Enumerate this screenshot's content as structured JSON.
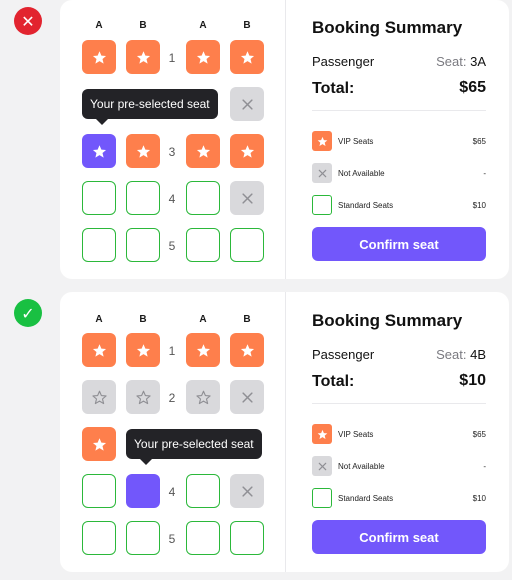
{
  "examples": [
    {
      "status": "incorrect",
      "columns": [
        "A",
        "B",
        "A",
        "B"
      ],
      "row_numbers": [
        "1",
        "",
        "3",
        "4",
        "5"
      ],
      "tooltip": "Your pre-selected seat",
      "summary": {
        "title": "Booking Summary",
        "passenger_label": "Passenger",
        "seat_prefix": "Seat:",
        "seat_value": "3A",
        "total_label": "Total:",
        "total_value": "$65",
        "legend": [
          {
            "label": "VIP Seats",
            "price": "$65"
          },
          {
            "label": "Not Available",
            "price": "-"
          },
          {
            "label": "Standard Seats",
            "price": "$10"
          }
        ],
        "confirm_label": "Confirm seat"
      }
    },
    {
      "status": "correct",
      "columns": [
        "A",
        "B",
        "A",
        "B"
      ],
      "row_numbers": [
        "1",
        "2",
        "",
        "4",
        "5"
      ],
      "tooltip": "Your pre-selected seat",
      "summary": {
        "title": "Booking Summary",
        "passenger_label": "Passenger",
        "seat_prefix": "Seat:",
        "seat_value": "4B",
        "total_label": "Total:",
        "total_value": "$10",
        "legend": [
          {
            "label": "VIP Seats",
            "price": "$65"
          },
          {
            "label": "Not Available",
            "price": "-"
          },
          {
            "label": "Standard Seats",
            "price": "$10"
          }
        ],
        "confirm_label": "Confirm seat"
      }
    }
  ],
  "colors": {
    "vip": "#fe7f4c",
    "not_available": "#d9d9dc",
    "standard_border": "#2bb83a",
    "selected": "#7257fb",
    "incorrect_badge": "#e2242f",
    "correct_badge": "#19c042"
  }
}
